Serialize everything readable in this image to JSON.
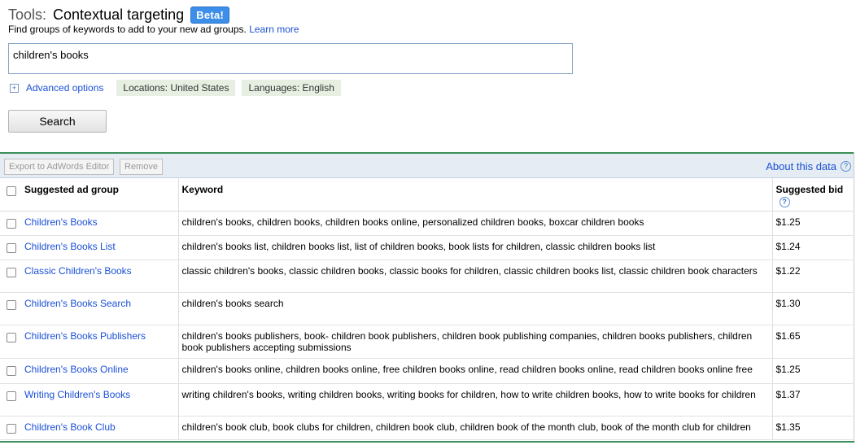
{
  "header": {
    "prefix": "Tools:",
    "title": "Contextual targeting",
    "badge": "Beta!",
    "subtitle": "Find groups of keywords to add to your new ad groups.",
    "learn_more": "Learn more"
  },
  "search": {
    "value": "children's books",
    "advanced_options": "Advanced options",
    "location_chip": "Locations: United States",
    "language_chip": "Languages: English",
    "button": "Search"
  },
  "toolbar": {
    "export": "Export to AdWords Editor",
    "remove": "Remove",
    "about": "About this data"
  },
  "table": {
    "columns": [
      "Suggested ad group",
      "Keyword",
      "Suggested bid"
    ],
    "rows": [
      {
        "group": "Children's Books",
        "keywords": "children's books, children books, children books online, personalized children books, boxcar children books",
        "bid": "$1.25"
      },
      {
        "group": "Children's Books List",
        "keywords": "children's books list, children books list, list of children books, book lists for children, classic children books list",
        "bid": "$1.24"
      },
      {
        "group": "Classic Children's Books",
        "keywords": "classic children's books, classic children books, classic books for children, classic children books list, classic children book characters",
        "bid": "$1.22"
      },
      {
        "group": "Children's Books Search",
        "keywords": "children's books search",
        "bid": "$1.30"
      },
      {
        "group": "Children's Books Publishers",
        "keywords": "children's books publishers, book- children book publishers, children book publishing companies, children books publishers, children book publishers accepting submissions",
        "bid": "$1.65"
      },
      {
        "group": "Children's Books Online",
        "keywords": "children's books online, children books online, free children books online, read children books online, read children books online free",
        "bid": "$1.25"
      },
      {
        "group": "Writing Children's Books",
        "keywords": "writing children's books, writing children books, writing books for children, how to write children books, how to write books for children",
        "bid": "$1.37"
      },
      {
        "group": "Children's Book Club",
        "keywords": "children's book club, book clubs for children, children book club, children book of the month club, book of the month club for children",
        "bid": "$1.35"
      }
    ]
  }
}
